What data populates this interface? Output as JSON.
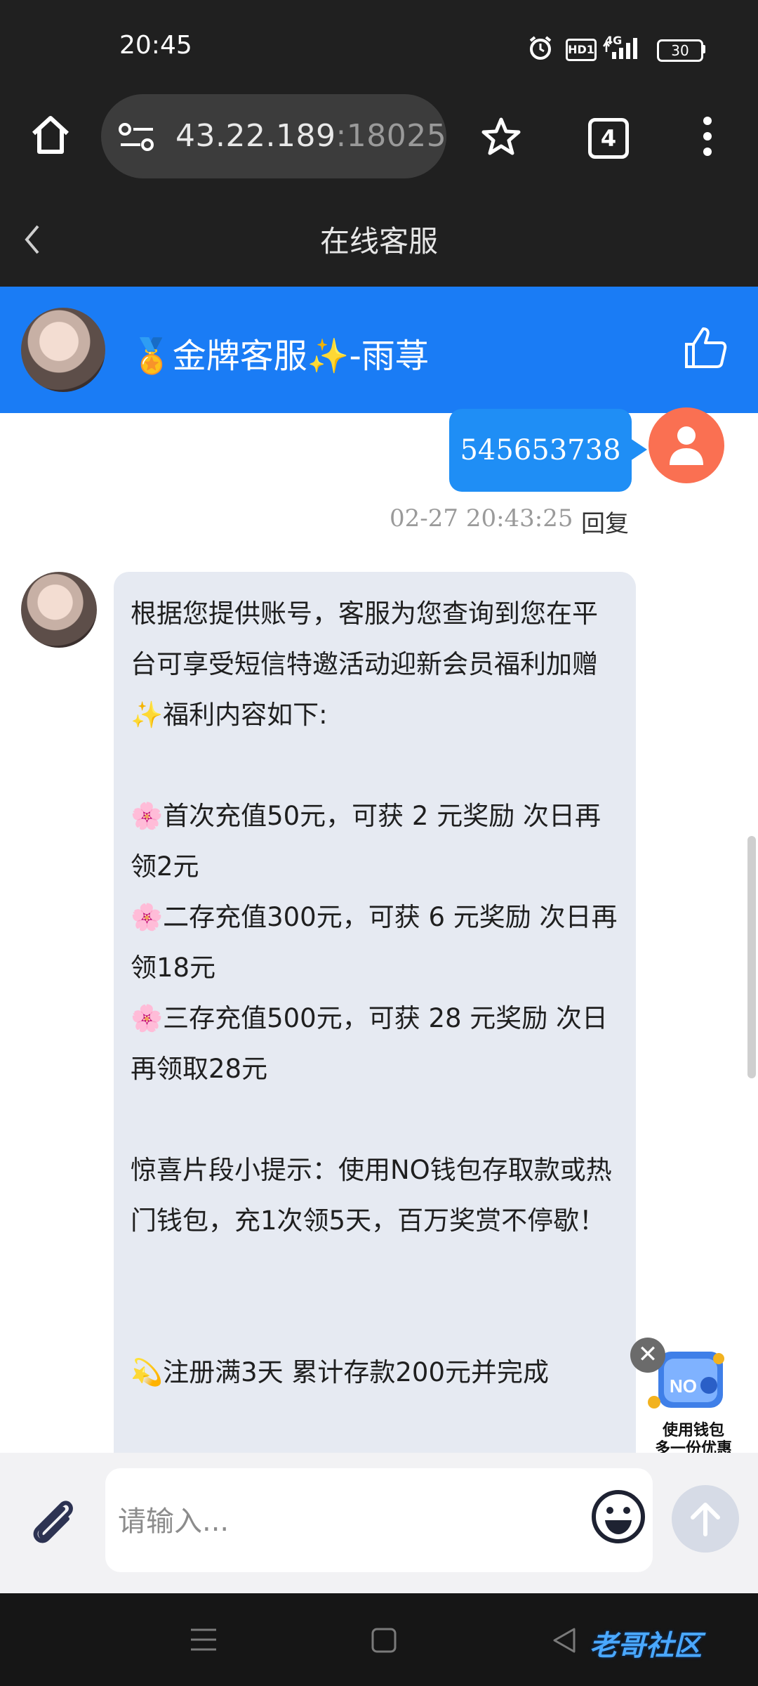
{
  "status_bar": {
    "time": "20:45",
    "battery": "30",
    "network": "4G",
    "hd_badge": "HD1",
    "icons": [
      "alarm-icon",
      "hd-icon",
      "signal-icon",
      "battery-icon"
    ]
  },
  "browser": {
    "url_host": "43.22.189",
    "url_port": ":18025",
    "tab_count": "4",
    "icons": [
      "home-icon",
      "site-settings-icon",
      "star-icon",
      "tabs-icon",
      "more-icon"
    ]
  },
  "page": {
    "title": "在线客服",
    "back_icon": "chevron-left-icon"
  },
  "agent": {
    "name": "🏅金牌客服✨-雨荨",
    "like_icon": "thumbs-up-icon"
  },
  "messages": {
    "user_message": "545653738",
    "timestamp": "02-27 20:43:25",
    "reply_label": "回复",
    "agent_message": "根据您提供账号，客服为您查询到您在平台可享受短信特邀活动迎新会员福利加赠✨福利内容如下:\n\n🌸首次充值50元，可获 2 元奖励 次日再领2元\n🌸二存充值300元，可获 6 元奖励 次日再领18元\n🌸三存充值500元，可获 28 元奖励 次日再领取28元\n\n惊喜片段小提示：使用NO钱包存取款或热门钱包，充1次领5天，百万奖赏不停歇！\n\n\n💫注册满3天 累计存款200元并完成"
  },
  "ad": {
    "close_label": "✕",
    "line1": "使用钱包",
    "line2": "多一份优惠",
    "badge": "NO"
  },
  "input": {
    "placeholder": "请输入...",
    "attach_icon": "paperclip-icon",
    "emoji_icon": "smiley-icon",
    "send_icon": "arrow-up-icon"
  },
  "watermark": "老哥社区",
  "colors": {
    "agent_bar": "#1a7cf5",
    "user_bubble": "#1f8ef5",
    "agent_bubble": "#e6eaf2",
    "user_avatar": "#fa7052",
    "chrome": "#202020"
  }
}
